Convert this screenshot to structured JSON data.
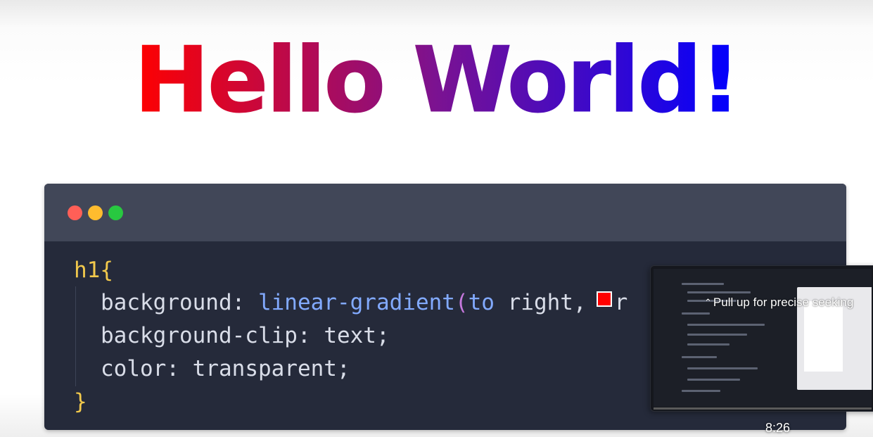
{
  "headline": {
    "text": "Hello World!",
    "gradient": [
      "#ff0000",
      "#7b1291",
      "#0000ff"
    ]
  },
  "window_dots": {
    "close": "#ff5f57",
    "minimize": "#febc2e",
    "maximize": "#28c840"
  },
  "code": {
    "line1": {
      "selector": "h1",
      "brace": "{"
    },
    "line2": {
      "property": "background",
      "colon": ":",
      "function": "linear-gradient",
      "open_paren": "(",
      "keyword": "to",
      "direction": " right,",
      "swatch_color": "#ff0000",
      "tail": "r"
    },
    "line3": {
      "property": "background-clip",
      "colon": ":",
      "value": "text;"
    },
    "line4": {
      "property": "color",
      "colon": ":",
      "value": "transparent;"
    },
    "line5": {
      "brace": "}"
    }
  },
  "preview": {
    "hint": "Pull up for precise seeking",
    "chevron_icon": "double-chevron-up-icon",
    "timestamp": "8:26"
  }
}
